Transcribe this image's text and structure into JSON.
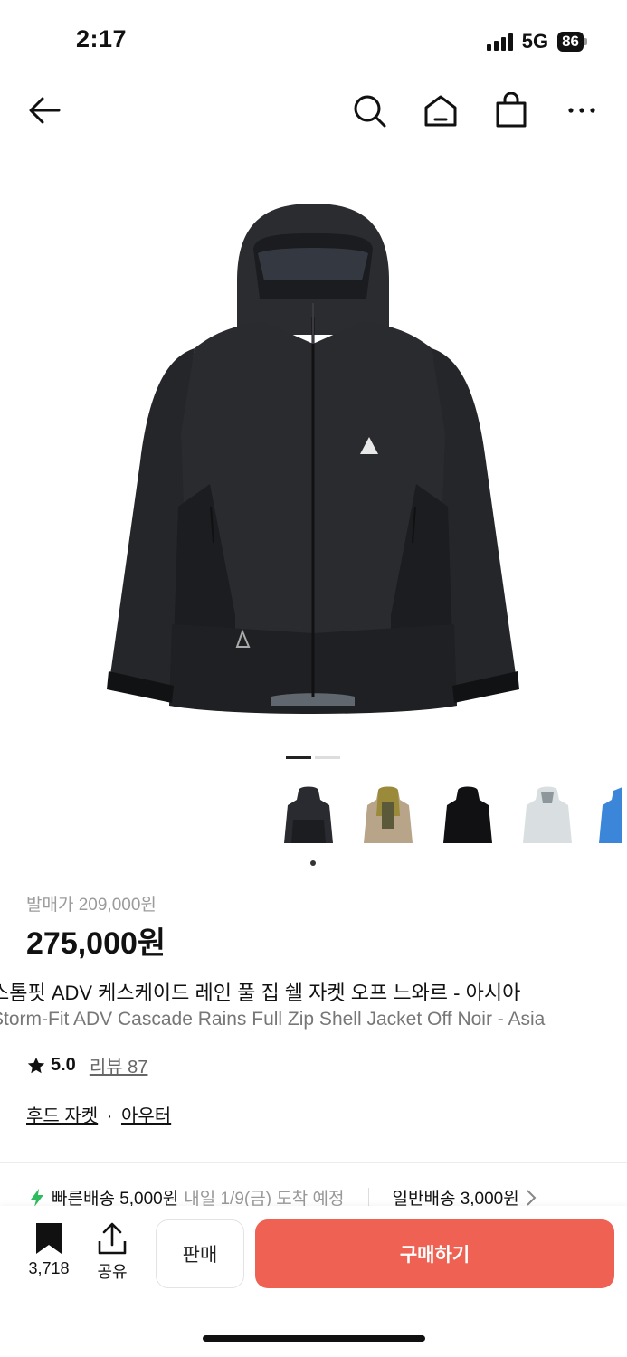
{
  "status_bar": {
    "time": "2:17",
    "network": "5G",
    "battery": "86"
  },
  "nav": {
    "back_icon": "arrow-left-icon",
    "search_icon": "search-icon",
    "home_icon": "home-icon",
    "bag_icon": "shopping-bag-icon",
    "more_icon": "more-icon"
  },
  "gallery": {
    "page_count": 2,
    "active_page": 1,
    "thumbnail_count": 5,
    "selected_thumbnail": 1
  },
  "product": {
    "release_price": "발매가 209,000원",
    "price": "275,000원",
    "name_ko": "스톰핏 ADV 케스케이드 레인 풀 집 쉘 자켓 오프 느와르 - 아시아",
    "name_en": "Storm-Fit ADV Cascade Rains Full Zip Shell Jacket Off Noir - Asia",
    "rating": "5.0",
    "review_label": "리뷰 87",
    "category_1": "후드 자켓",
    "category_sep": "·",
    "category_2": "아우터"
  },
  "shipping": {
    "fast_label": "빠른배송 5,000원",
    "fast_eta": "내일 1/9(금) 도착 예정",
    "normal_label": "일반배송 3,000원"
  },
  "bottom": {
    "bookmark_count": "3,718",
    "share_label": "공유",
    "sell_label": "판매",
    "buy_label": "구매하기"
  },
  "colors": {
    "accent": "#ef6253",
    "fast_icon": "#2dbb5d"
  }
}
